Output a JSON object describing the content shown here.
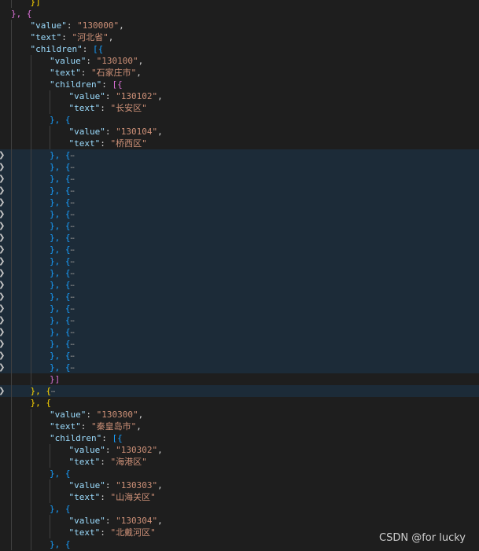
{
  "fold_icon": "chevron-right-icon",
  "colors": {
    "background": "#1e1e1e",
    "folded_background": "#1c2b38",
    "key": "#9cdcfe",
    "string": "#ce9178",
    "bracket_level_1": "#ffd700",
    "bracket_level_2": "#da70d6",
    "bracket_level_3": "#179fff"
  },
  "fold_placeholder": "⋯",
  "lines": [
    {
      "indent": 1,
      "tokens": [
        {
          "t": "}]",
          "c": "br1"
        }
      ]
    },
    {
      "indent": 0,
      "tokens": [
        {
          "t": "}, {",
          "c": "br2"
        }
      ]
    },
    {
      "indent": 1,
      "tokens": [
        {
          "t": "\"value\"",
          "c": "key"
        },
        {
          "t": ": ",
          "c": "pun"
        },
        {
          "t": "\"130000\"",
          "c": "str"
        },
        {
          "t": ",",
          "c": "pun"
        }
      ]
    },
    {
      "indent": 1,
      "tokens": [
        {
          "t": "\"text\"",
          "c": "key"
        },
        {
          "t": ": ",
          "c": "pun"
        },
        {
          "t": "\"河北省\"",
          "c": "str"
        },
        {
          "t": ",",
          "c": "pun"
        }
      ]
    },
    {
      "indent": 1,
      "tokens": [
        {
          "t": "\"children\"",
          "c": "key"
        },
        {
          "t": ": ",
          "c": "pun"
        },
        {
          "t": "[{",
          "c": "br3"
        }
      ]
    },
    {
      "indent": 2,
      "tokens": [
        {
          "t": "\"value\"",
          "c": "key"
        },
        {
          "t": ": ",
          "c": "pun"
        },
        {
          "t": "\"130100\"",
          "c": "str"
        },
        {
          "t": ",",
          "c": "pun"
        }
      ]
    },
    {
      "indent": 2,
      "tokens": [
        {
          "t": "\"text\"",
          "c": "key"
        },
        {
          "t": ": ",
          "c": "pun"
        },
        {
          "t": "\"石家庄市\"",
          "c": "str"
        },
        {
          "t": ",",
          "c": "pun"
        }
      ]
    },
    {
      "indent": 2,
      "tokens": [
        {
          "t": "\"children\"",
          "c": "key"
        },
        {
          "t": ": ",
          "c": "pun"
        },
        {
          "t": "[{",
          "c": "br2"
        }
      ]
    },
    {
      "indent": 3,
      "tokens": [
        {
          "t": "\"value\"",
          "c": "key"
        },
        {
          "t": ": ",
          "c": "pun"
        },
        {
          "t": "\"130102\"",
          "c": "str"
        },
        {
          "t": ",",
          "c": "pun"
        }
      ]
    },
    {
      "indent": 3,
      "tokens": [
        {
          "t": "\"text\"",
          "c": "key"
        },
        {
          "t": ": ",
          "c": "pun"
        },
        {
          "t": "\"长安区\"",
          "c": "str"
        }
      ]
    },
    {
      "indent": 2,
      "tokens": [
        {
          "t": "}, {",
          "c": "br3"
        }
      ]
    },
    {
      "indent": 3,
      "tokens": [
        {
          "t": "\"value\"",
          "c": "key"
        },
        {
          "t": ": ",
          "c": "pun"
        },
        {
          "t": "\"130104\"",
          "c": "str"
        },
        {
          "t": ",",
          "c": "pun"
        }
      ]
    },
    {
      "indent": 3,
      "tokens": [
        {
          "t": "\"text\"",
          "c": "key"
        },
        {
          "t": ": ",
          "c": "pun"
        },
        {
          "t": "\"桥西区\"",
          "c": "str"
        }
      ]
    },
    {
      "indent": 2,
      "folded": true,
      "tokens": [
        {
          "t": "}, {",
          "c": "br3"
        },
        {
          "t": "⋯",
          "c": "ell"
        }
      ]
    },
    {
      "indent": 2,
      "folded": true,
      "tokens": [
        {
          "t": "}, {",
          "c": "br3"
        },
        {
          "t": "⋯",
          "c": "ell"
        }
      ]
    },
    {
      "indent": 2,
      "folded": true,
      "tokens": [
        {
          "t": "}, {",
          "c": "br3"
        },
        {
          "t": "⋯",
          "c": "ell"
        }
      ]
    },
    {
      "indent": 2,
      "folded": true,
      "tokens": [
        {
          "t": "}, {",
          "c": "br3"
        },
        {
          "t": "⋯",
          "c": "ell"
        }
      ]
    },
    {
      "indent": 2,
      "folded": true,
      "tokens": [
        {
          "t": "}, {",
          "c": "br3"
        },
        {
          "t": "⋯",
          "c": "ell"
        }
      ]
    },
    {
      "indent": 2,
      "folded": true,
      "tokens": [
        {
          "t": "}, {",
          "c": "br3"
        },
        {
          "t": "⋯",
          "c": "ell"
        }
      ]
    },
    {
      "indent": 2,
      "folded": true,
      "tokens": [
        {
          "t": "}, {",
          "c": "br3"
        },
        {
          "t": "⋯",
          "c": "ell"
        }
      ]
    },
    {
      "indent": 2,
      "folded": true,
      "tokens": [
        {
          "t": "}, {",
          "c": "br3"
        },
        {
          "t": "⋯",
          "c": "ell"
        }
      ]
    },
    {
      "indent": 2,
      "folded": true,
      "tokens": [
        {
          "t": "}, {",
          "c": "br3"
        },
        {
          "t": "⋯",
          "c": "ell"
        }
      ]
    },
    {
      "indent": 2,
      "folded": true,
      "tokens": [
        {
          "t": "}, {",
          "c": "br3"
        },
        {
          "t": "⋯",
          "c": "ell"
        }
      ]
    },
    {
      "indent": 2,
      "folded": true,
      "tokens": [
        {
          "t": "}, {",
          "c": "br3"
        },
        {
          "t": "⋯",
          "c": "ell"
        }
      ]
    },
    {
      "indent": 2,
      "folded": true,
      "tokens": [
        {
          "t": "}, {",
          "c": "br3"
        },
        {
          "t": "⋯",
          "c": "ell"
        }
      ]
    },
    {
      "indent": 2,
      "folded": true,
      "tokens": [
        {
          "t": "}, {",
          "c": "br3"
        },
        {
          "t": "⋯",
          "c": "ell"
        }
      ]
    },
    {
      "indent": 2,
      "folded": true,
      "tokens": [
        {
          "t": "}, {",
          "c": "br3"
        },
        {
          "t": "⋯",
          "c": "ell"
        }
      ]
    },
    {
      "indent": 2,
      "folded": true,
      "tokens": [
        {
          "t": "}, {",
          "c": "br3"
        },
        {
          "t": "⋯",
          "c": "ell"
        }
      ]
    },
    {
      "indent": 2,
      "folded": true,
      "tokens": [
        {
          "t": "}, {",
          "c": "br3"
        },
        {
          "t": "⋯",
          "c": "ell"
        }
      ]
    },
    {
      "indent": 2,
      "folded": true,
      "tokens": [
        {
          "t": "}, {",
          "c": "br3"
        },
        {
          "t": "⋯",
          "c": "ell"
        }
      ]
    },
    {
      "indent": 2,
      "folded": true,
      "tokens": [
        {
          "t": "}, {",
          "c": "br3"
        },
        {
          "t": "⋯",
          "c": "ell"
        }
      ]
    },
    {
      "indent": 2,
      "folded": true,
      "tokens": [
        {
          "t": "}, {",
          "c": "br3"
        },
        {
          "t": "⋯",
          "c": "ell"
        }
      ]
    },
    {
      "indent": 2,
      "tokens": [
        {
          "t": "}]",
          "c": "br2"
        }
      ]
    },
    {
      "indent": 1,
      "folded": true,
      "tokens": [
        {
          "t": "}, {",
          "c": "br1"
        },
        {
          "t": "⋯",
          "c": "ell"
        }
      ]
    },
    {
      "indent": 1,
      "tokens": [
        {
          "t": "}, {",
          "c": "br1"
        }
      ]
    },
    {
      "indent": 2,
      "tokens": [
        {
          "t": "\"value\"",
          "c": "key"
        },
        {
          "t": ": ",
          "c": "pun"
        },
        {
          "t": "\"130300\"",
          "c": "str"
        },
        {
          "t": ",",
          "c": "pun"
        }
      ]
    },
    {
      "indent": 2,
      "tokens": [
        {
          "t": "\"text\"",
          "c": "key"
        },
        {
          "t": ": ",
          "c": "pun"
        },
        {
          "t": "\"秦皇岛市\"",
          "c": "str"
        },
        {
          "t": ",",
          "c": "pun"
        }
      ]
    },
    {
      "indent": 2,
      "tokens": [
        {
          "t": "\"children\"",
          "c": "key"
        },
        {
          "t": ": ",
          "c": "pun"
        },
        {
          "t": "[{",
          "c": "br3"
        }
      ]
    },
    {
      "indent": 3,
      "tokens": [
        {
          "t": "\"value\"",
          "c": "key"
        },
        {
          "t": ": ",
          "c": "pun"
        },
        {
          "t": "\"130302\"",
          "c": "str"
        },
        {
          "t": ",",
          "c": "pun"
        }
      ]
    },
    {
      "indent": 3,
      "tokens": [
        {
          "t": "\"text\"",
          "c": "key"
        },
        {
          "t": ": ",
          "c": "pun"
        },
        {
          "t": "\"海港区\"",
          "c": "str"
        }
      ]
    },
    {
      "indent": 2,
      "tokens": [
        {
          "t": "}, {",
          "c": "br3"
        }
      ]
    },
    {
      "indent": 3,
      "tokens": [
        {
          "t": "\"value\"",
          "c": "key"
        },
        {
          "t": ": ",
          "c": "pun"
        },
        {
          "t": "\"130303\"",
          "c": "str"
        },
        {
          "t": ",",
          "c": "pun"
        }
      ]
    },
    {
      "indent": 3,
      "tokens": [
        {
          "t": "\"text\"",
          "c": "key"
        },
        {
          "t": ": ",
          "c": "pun"
        },
        {
          "t": "\"山海关区\"",
          "c": "str"
        }
      ]
    },
    {
      "indent": 2,
      "tokens": [
        {
          "t": "}, {",
          "c": "br3"
        }
      ]
    },
    {
      "indent": 3,
      "tokens": [
        {
          "t": "\"value\"",
          "c": "key"
        },
        {
          "t": ": ",
          "c": "pun"
        },
        {
          "t": "\"130304\"",
          "c": "str"
        },
        {
          "t": ",",
          "c": "pun"
        }
      ]
    },
    {
      "indent": 3,
      "tokens": [
        {
          "t": "\"text\"",
          "c": "key"
        },
        {
          "t": ": ",
          "c": "pun"
        },
        {
          "t": "\"北戴河区\"",
          "c": "str"
        }
      ]
    },
    {
      "indent": 2,
      "tokens": [
        {
          "t": "}, {",
          "c": "br3"
        }
      ]
    }
  ],
  "watermark": "CSDN @for lucky"
}
